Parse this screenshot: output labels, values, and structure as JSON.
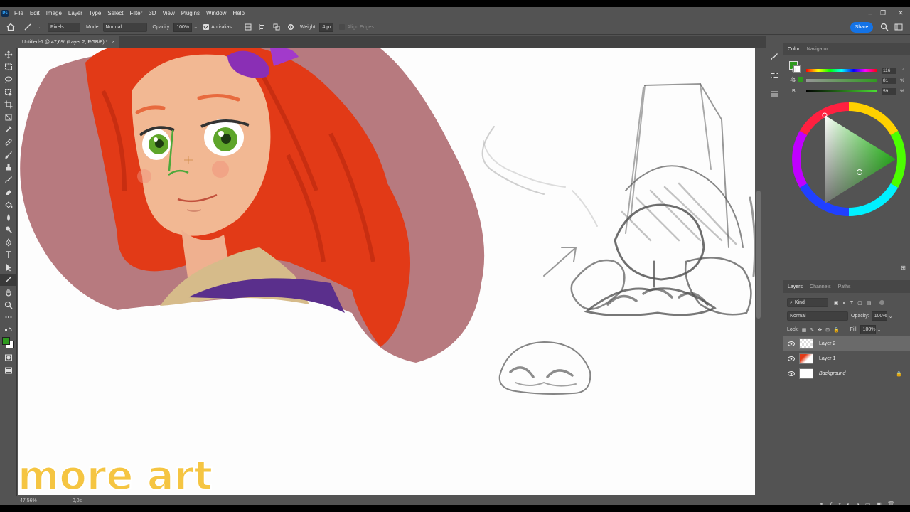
{
  "app": {
    "logo": "Ps"
  },
  "menu": [
    "File",
    "Edit",
    "Image",
    "Layer",
    "Type",
    "Select",
    "Filter",
    "3D",
    "View",
    "Plugins",
    "Window",
    "Help"
  ],
  "options": {
    "source": "Pixels",
    "mode_label": "Mode:",
    "mode_value": "Normal",
    "opacity_label": "Opacity:",
    "opacity_value": "100%",
    "antialias_label": "Anti-alias",
    "weight_label": "Weight:",
    "weight_value": "4 px",
    "align_edges_label": "Align Edges",
    "share_label": "Share"
  },
  "document": {
    "tab_title": "Untitled-1 @ 47,6% (Layer 2, RGB/8) *"
  },
  "status": {
    "zoom": "47,56%",
    "info": "0,0s"
  },
  "color_panel": {
    "tabs": [
      "Color",
      "Navigator"
    ],
    "sliders": [
      {
        "label": "H",
        "value": "116",
        "unit": "°"
      },
      {
        "label": "S",
        "value": "81",
        "unit": "%"
      },
      {
        "label": "B",
        "value": "59",
        "unit": "%"
      }
    ],
    "foreground": "#2f9a1f"
  },
  "layers_panel": {
    "tabs": [
      "Layers",
      "Channels",
      "Paths"
    ],
    "filter_label": "Kind",
    "blend_mode": "Normal",
    "opacity_label": "Opacity:",
    "opacity_value": "100%",
    "lock_label": "Lock:",
    "fill_label": "Fill:",
    "fill_value": "100%",
    "layers": [
      {
        "name": "Layer 2",
        "selected": true
      },
      {
        "name": "Layer 1",
        "selected": false
      },
      {
        "name": "Background",
        "selected": false
      }
    ]
  },
  "watermark": {
    "text": "more art"
  }
}
